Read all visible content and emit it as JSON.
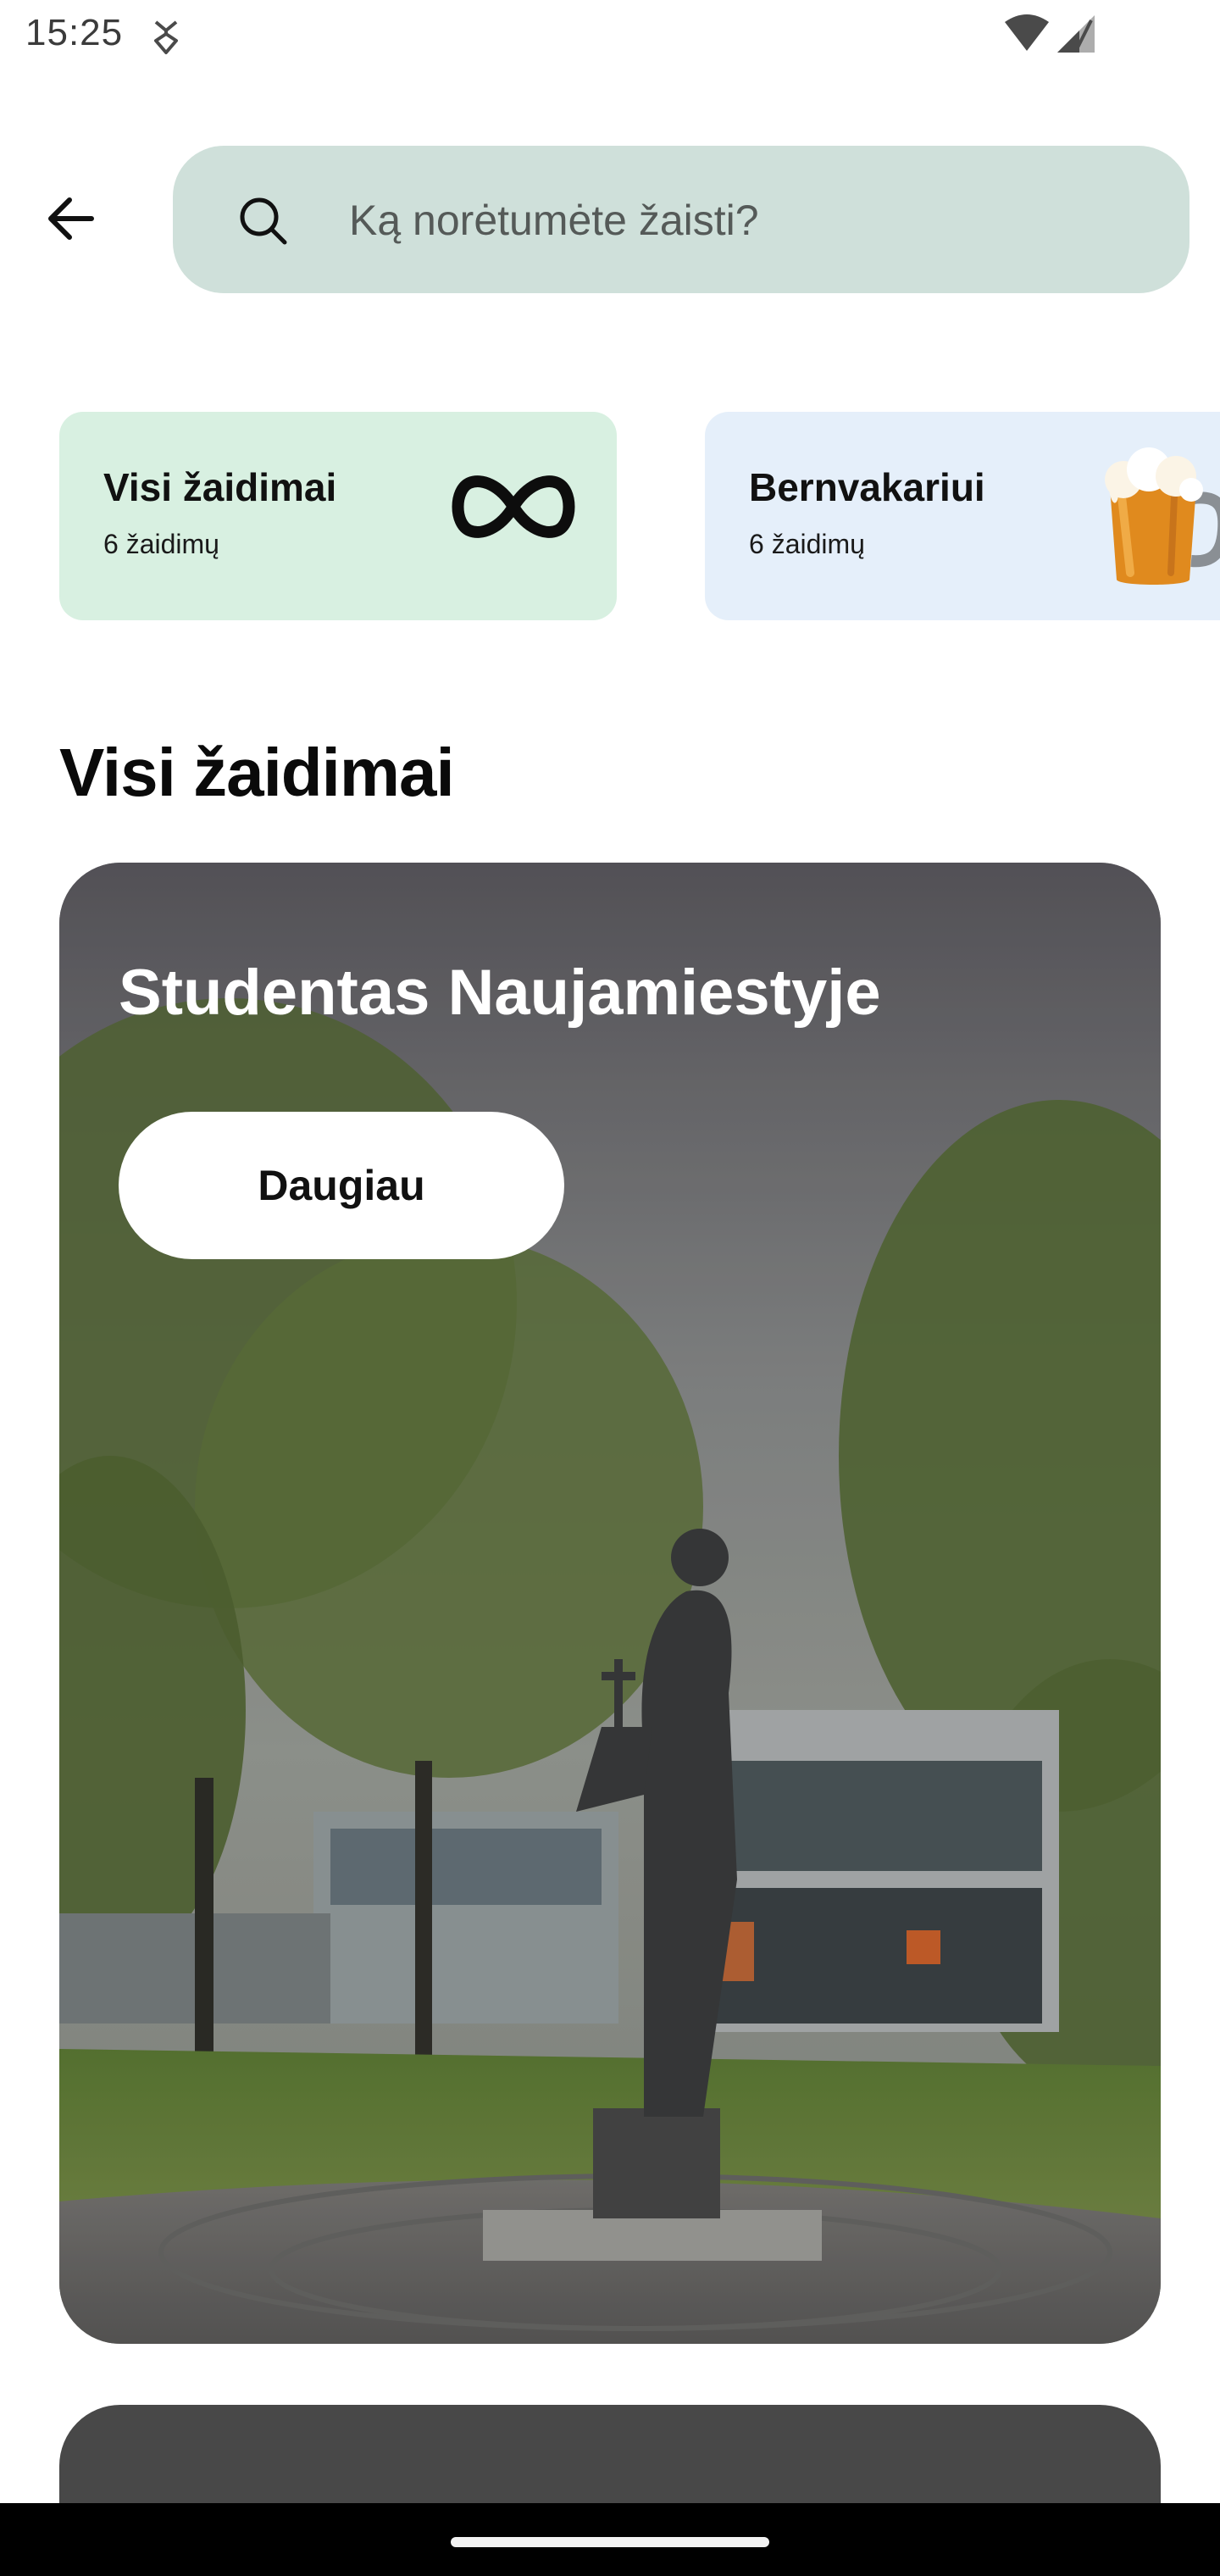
{
  "status_bar": {
    "time": "15:25"
  },
  "search": {
    "placeholder": "Ką norėtumėte žaisti?",
    "value": ""
  },
  "categories": [
    {
      "title": "Visi žaidimai",
      "count": "6 žaidimų",
      "icon": "infinity-icon",
      "bg": "#d8f0e1"
    },
    {
      "title": "Bernvakariui",
      "count": "6 žaidimų",
      "icon": "beer-mug-icon",
      "bg": "#e5effa"
    }
  ],
  "section": {
    "title": "Visi žaidimai"
  },
  "games": [
    {
      "title": "Studentas Naujamiestyje",
      "button_label": "Daugiau"
    }
  ],
  "colors": {
    "search_bg": "#cfe0da",
    "card_green": "#d8f0e1",
    "card_blue": "#e5effa",
    "nav_bar": "#000000"
  }
}
